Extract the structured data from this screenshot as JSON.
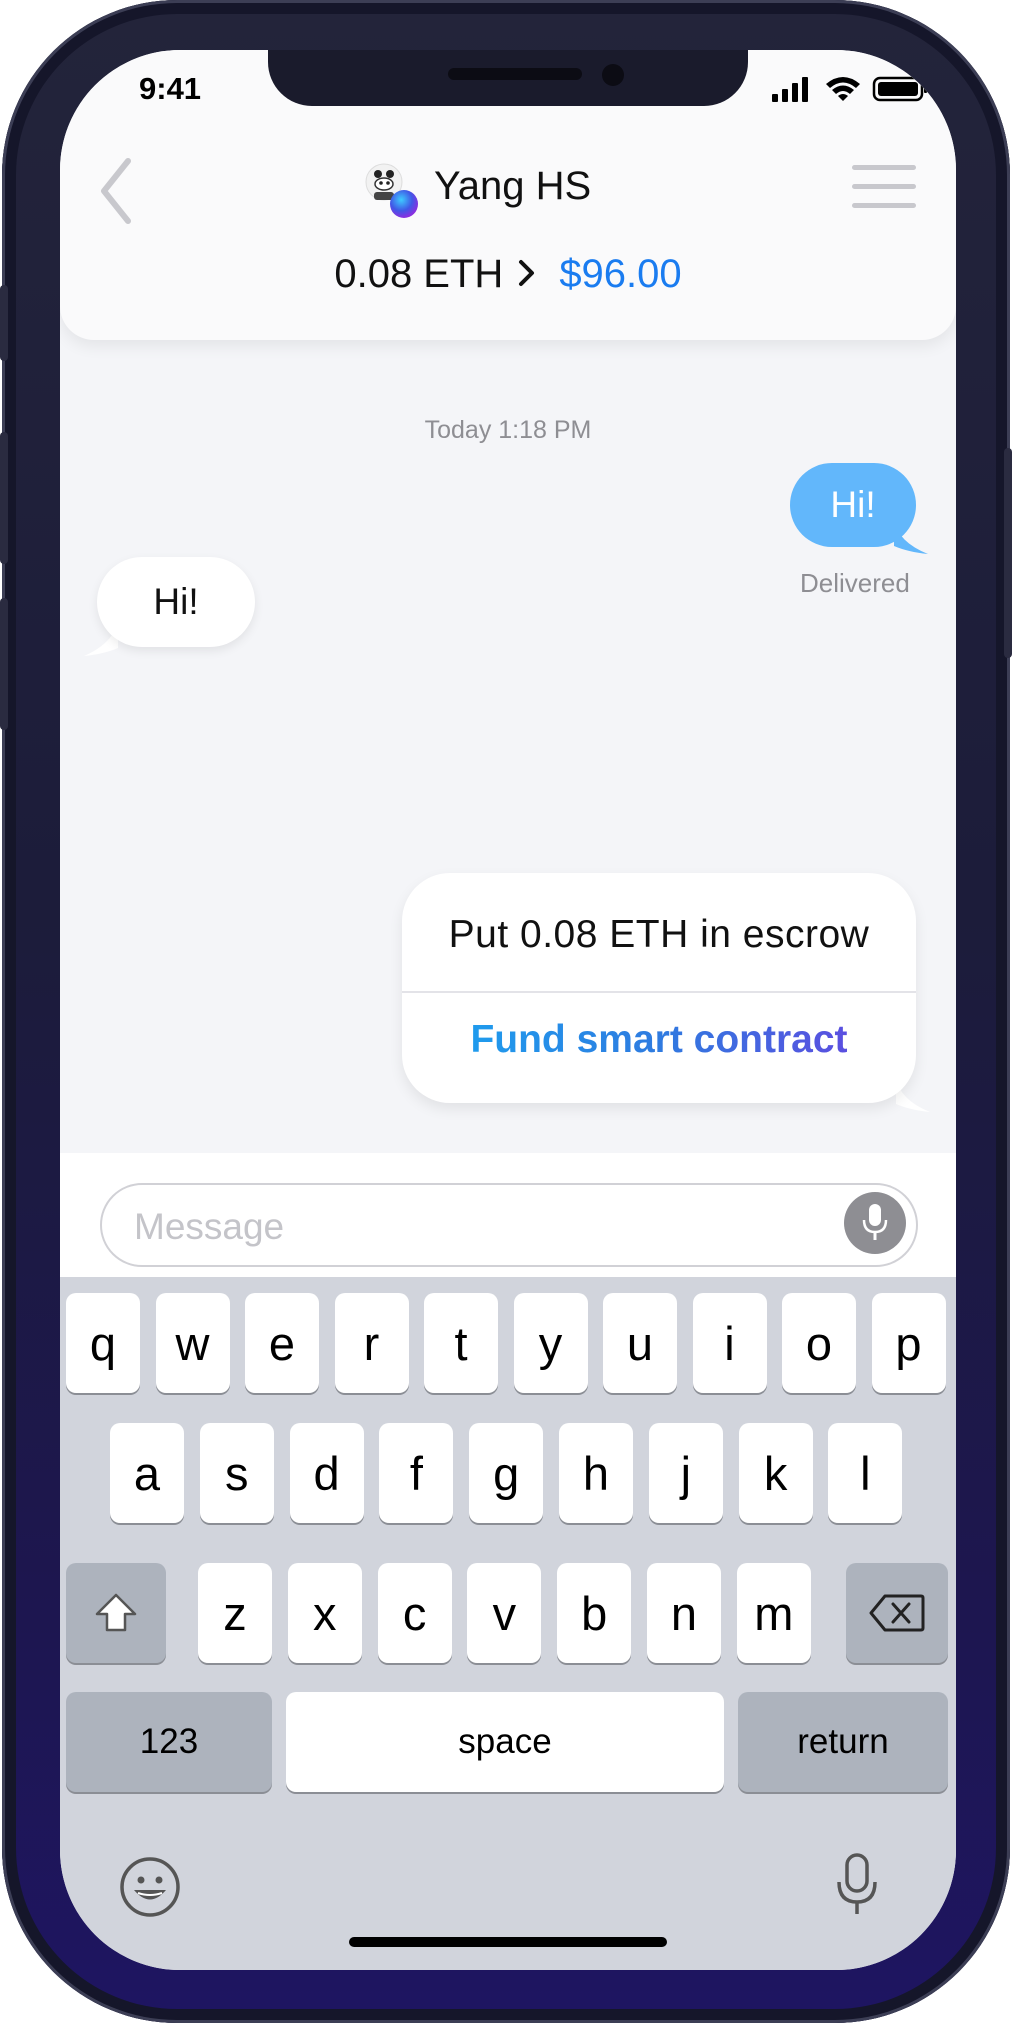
{
  "status_bar": {
    "time": "9:41"
  },
  "header": {
    "contact_name": "Yang HS",
    "amount_eth": "0.08 ETH",
    "amount_usd": "$96.00"
  },
  "conversation": {
    "timestamp": "Today 1:18 PM",
    "sent_message": "Hi!",
    "sent_status": "Delivered",
    "received_message": "Hi!",
    "escrow_card": {
      "text": "Put 0.08 ETH in escrow",
      "action_label": "Fund smart contract"
    }
  },
  "composer": {
    "placeholder": "Message"
  },
  "keyboard": {
    "row1": [
      "q",
      "w",
      "e",
      "r",
      "t",
      "y",
      "u",
      "i",
      "o",
      "p"
    ],
    "row2": [
      "a",
      "s",
      "d",
      "f",
      "g",
      "h",
      "j",
      "k",
      "l"
    ],
    "row3": [
      "z",
      "x",
      "c",
      "v",
      "b",
      "n",
      "m"
    ],
    "numbers_label": "123",
    "space_label": "space",
    "return_label": "return"
  },
  "colors": {
    "accent_blue": "#1a7cf0",
    "sent_bubble": "#62b7fb",
    "action_gradient_start": "#19a7f2",
    "action_gradient_end": "#6a3fe0"
  },
  "icons": [
    "back-chevron-icon",
    "menu-icon",
    "avatar",
    "signal-icon",
    "wifi-icon",
    "battery-icon",
    "microphone-icon",
    "shift-icon",
    "backspace-icon",
    "emoji-icon",
    "dictation-icon"
  ]
}
